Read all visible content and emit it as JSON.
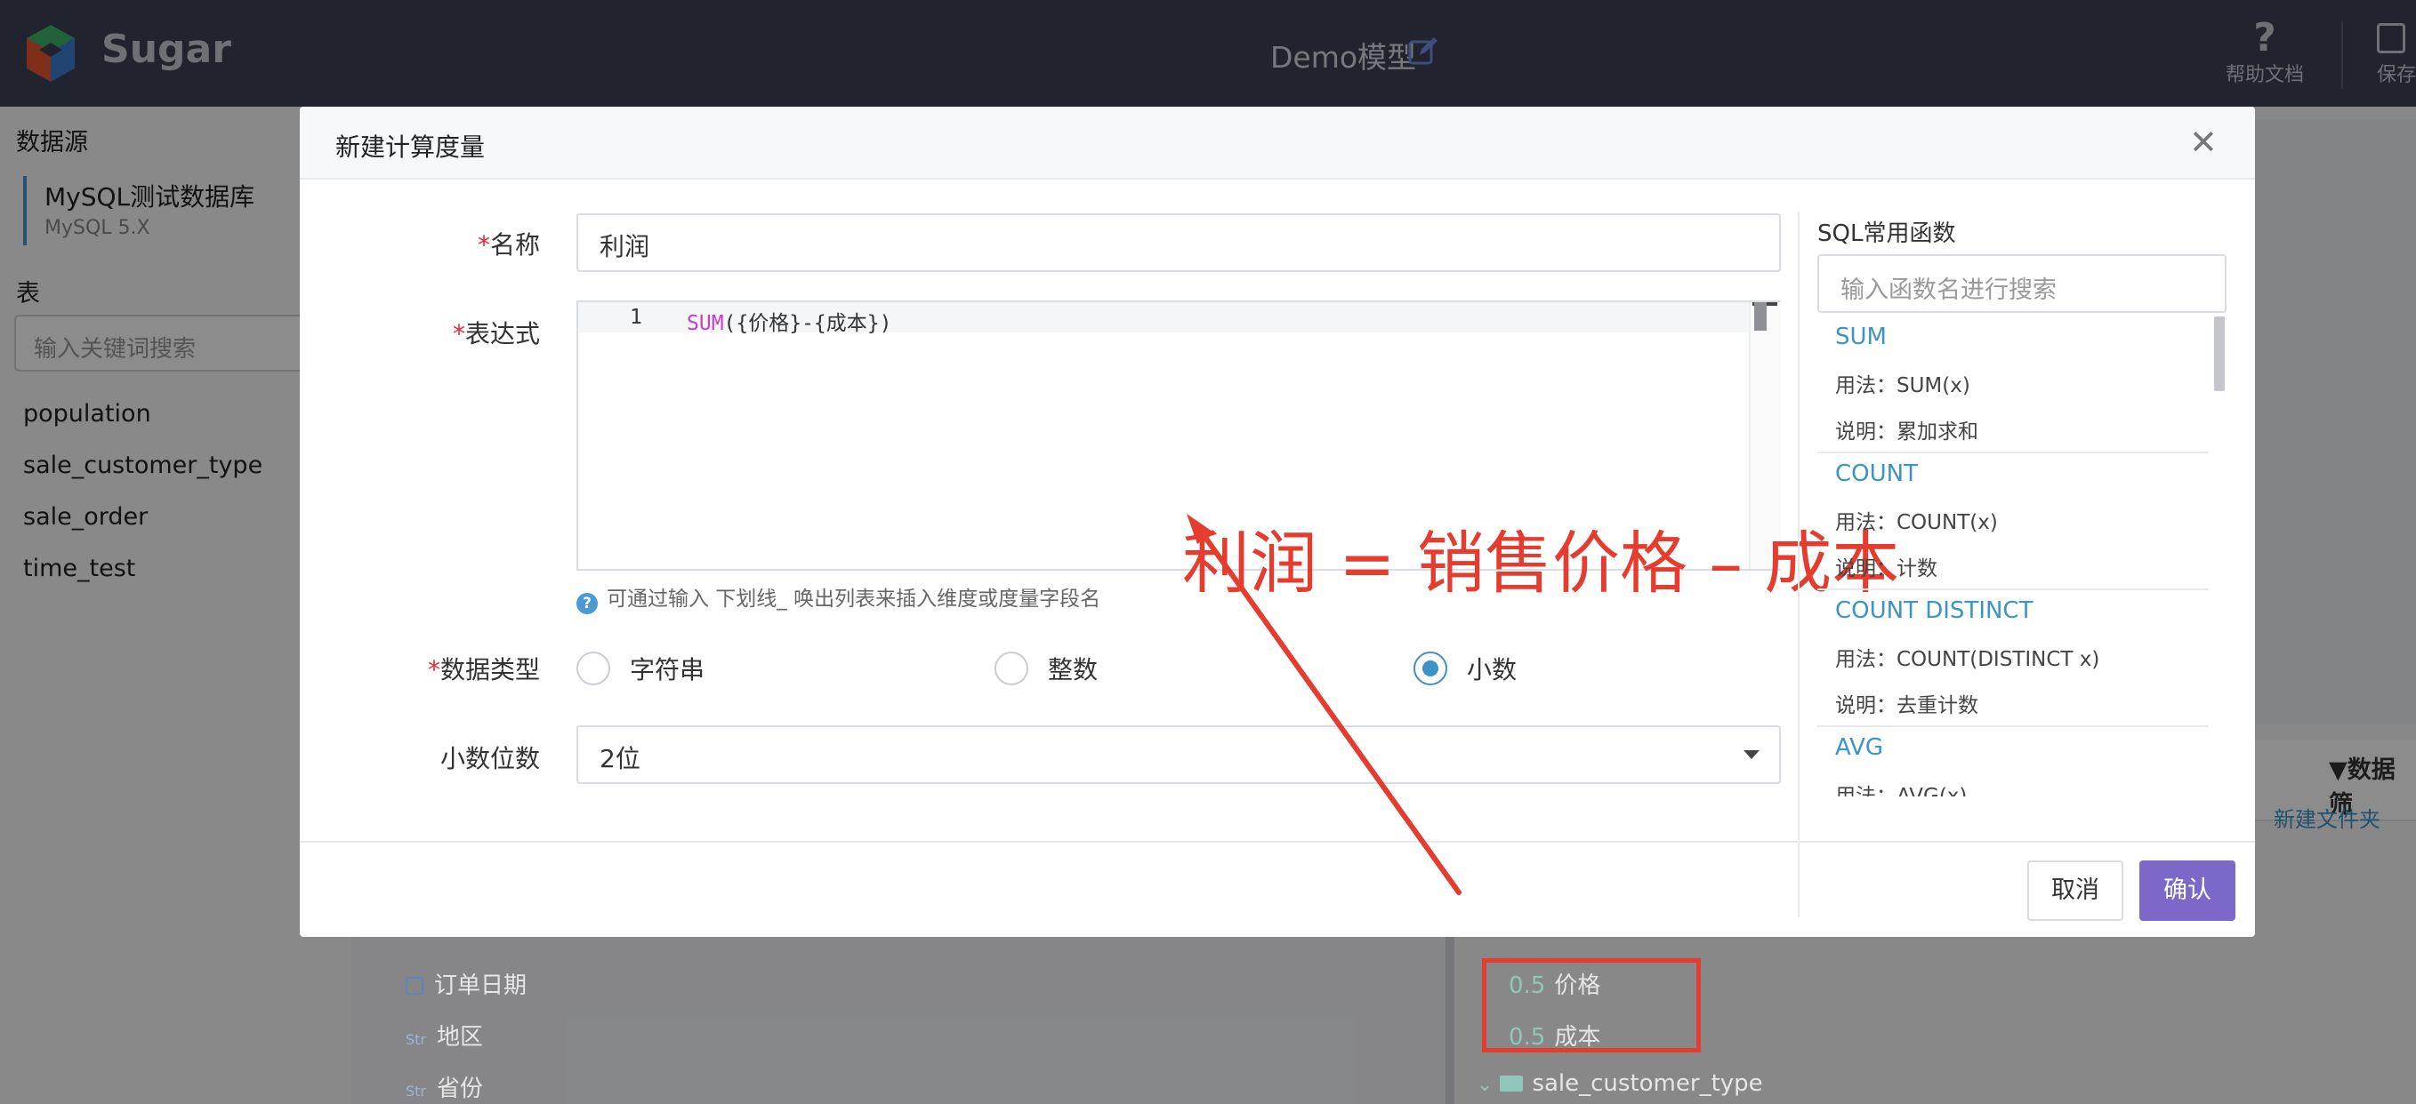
{
  "header": {
    "brand": "Sugar",
    "doc_title": "Demo模型",
    "help_label": "帮助文档",
    "save_label": "保存"
  },
  "left_panel": {
    "datasource_heading": "数据源",
    "datasource_name": "MySQL测试数据库",
    "datasource_version": "MySQL 5.X",
    "tables_heading": "表",
    "table_search_placeholder": "输入关键词搜索",
    "tables": [
      "population",
      "sale_customer_type",
      "sale_order",
      "time_test"
    ]
  },
  "right_panel": {
    "filter_label": "数据筛",
    "new_folder": "新建文件夹"
  },
  "fields_left": [
    {
      "tag": "",
      "name": "订单日期"
    },
    {
      "tag": "Str",
      "name": "地区"
    },
    {
      "tag": "Str",
      "name": "省份"
    }
  ],
  "fields_right": [
    {
      "tag": "0.5",
      "name": "价格"
    },
    {
      "tag": "0.5",
      "name": "成本"
    }
  ],
  "folder_right": "sale_customer_type",
  "dialog": {
    "title": "新建计算度量",
    "required_mark": "*",
    "name_label": "名称",
    "name_value": "利润",
    "expr_label": "表达式",
    "line_number": "1",
    "code_fn": "SUM",
    "code_rest": "({价格}-{成本})",
    "annotation": "利润 = 销售价格 – 成本",
    "hint_icon": "?",
    "hint": "可通过输入 下划线_ 唤出列表来插入维度或度量字段名",
    "type_label": "数据类型",
    "types": [
      "字符串",
      "整数",
      "小数"
    ],
    "selected_type": "小数",
    "decimals_label": "小数位数",
    "decimals_value": "2位",
    "cancel": "取消",
    "ok": "确认"
  },
  "sql_panel": {
    "title": "SQL常用函数",
    "search_placeholder": "输入函数名进行搜索",
    "functions": [
      {
        "name": "SUM",
        "usage": "用法：SUM(x)",
        "desc": "说明：累加求和"
      },
      {
        "name": "COUNT",
        "usage": "用法：COUNT(x)",
        "desc": "说明：计数"
      },
      {
        "name": "COUNT DISTINCT",
        "usage": "用法：COUNT(DISTINCT x)",
        "desc": "说明：去重计数"
      },
      {
        "name": "AVG",
        "usage": "用法：AVG(x)",
        "desc": ""
      }
    ]
  },
  "colors": {
    "header_bg": "#3c4156",
    "accent": "#3c93c7",
    "primary_button": "#7b68c8",
    "annotation_red": "#e43c2f"
  },
  "icons": [
    "sugar-logo-icon",
    "edit-icon",
    "help-icon",
    "save-icon",
    "close-icon",
    "info-icon",
    "chevron-down-icon",
    "calendar-icon",
    "folder-icon",
    "filter-icon"
  ]
}
